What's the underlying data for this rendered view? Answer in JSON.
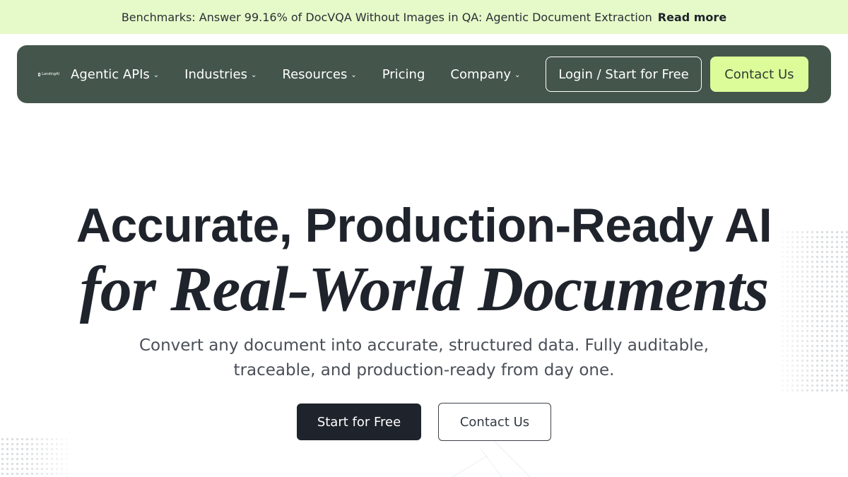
{
  "announcement": {
    "text": "Benchmarks: Answer 99.16% of DocVQA Without Images in QA: Agentic Document Extraction",
    "link": "Read more"
  },
  "nav": {
    "logo_text": "LandingAI",
    "items": [
      {
        "label": "Agentic APIs",
        "dropdown": true
      },
      {
        "label": "Industries",
        "dropdown": true
      },
      {
        "label": "Resources",
        "dropdown": true
      },
      {
        "label": "Pricing",
        "dropdown": false
      },
      {
        "label": "Company",
        "dropdown": true
      }
    ],
    "login_label": "Login / Start for Free",
    "contact_label": "Contact Us"
  },
  "hero": {
    "title_line1": "Accurate, Production-Ready AI",
    "title_line2": "for Real-World Documents",
    "subtitle_line1": "Convert any document into accurate, structured data. Fully auditable,",
    "subtitle_line2": "traceable, and production-ready from day one.",
    "primary_cta": "Start for Free",
    "secondary_cta": "Contact Us"
  },
  "colors": {
    "announcement_bg": "#e6fac9",
    "nav_bg": "#44554b",
    "accent": "#dcfc9a",
    "text_dark": "#1f232b"
  },
  "icons": {
    "dropdown": "chevron-down-icon",
    "logo": "landingai-logo-icon"
  }
}
